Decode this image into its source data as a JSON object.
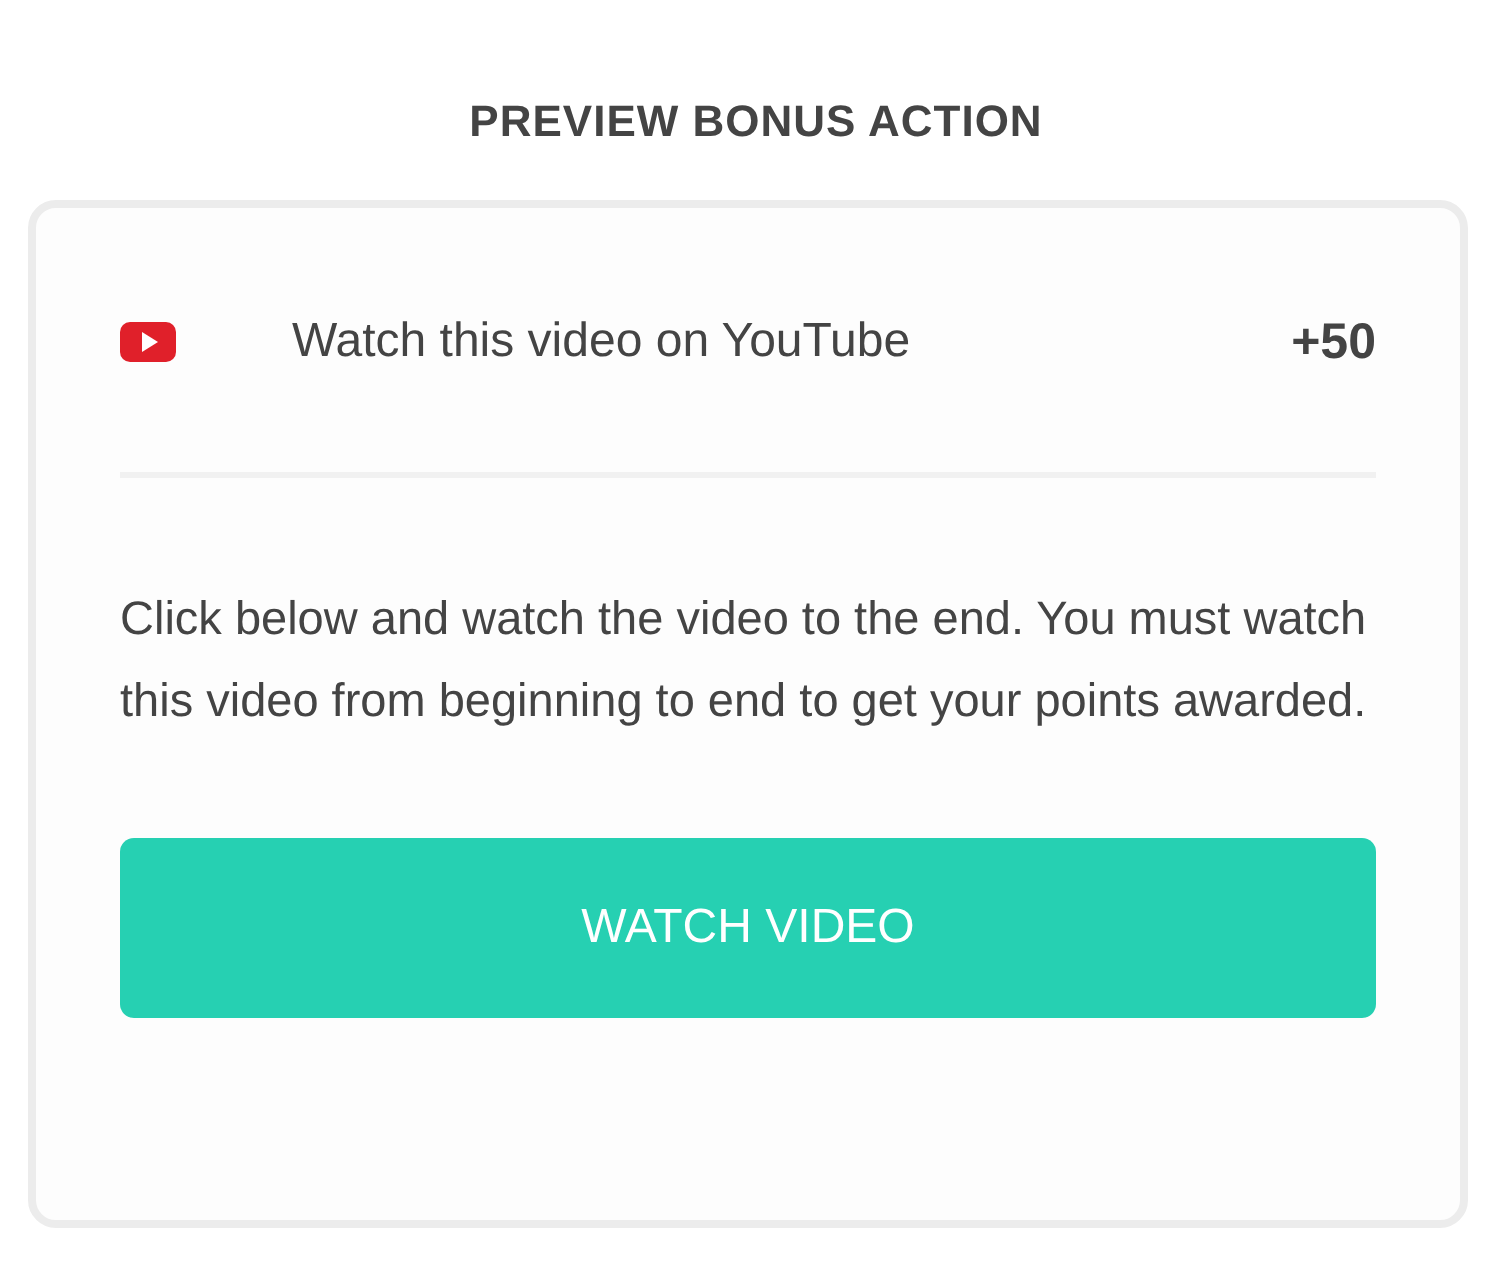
{
  "heading": "PREVIEW BONUS ACTION",
  "action": {
    "label": "Watch this video on YouTube",
    "points": "+50"
  },
  "description": "Click below and watch the video to the end. You must watch this video from beginning to end to get your points awarded.",
  "button": "WATCH VIDEO"
}
